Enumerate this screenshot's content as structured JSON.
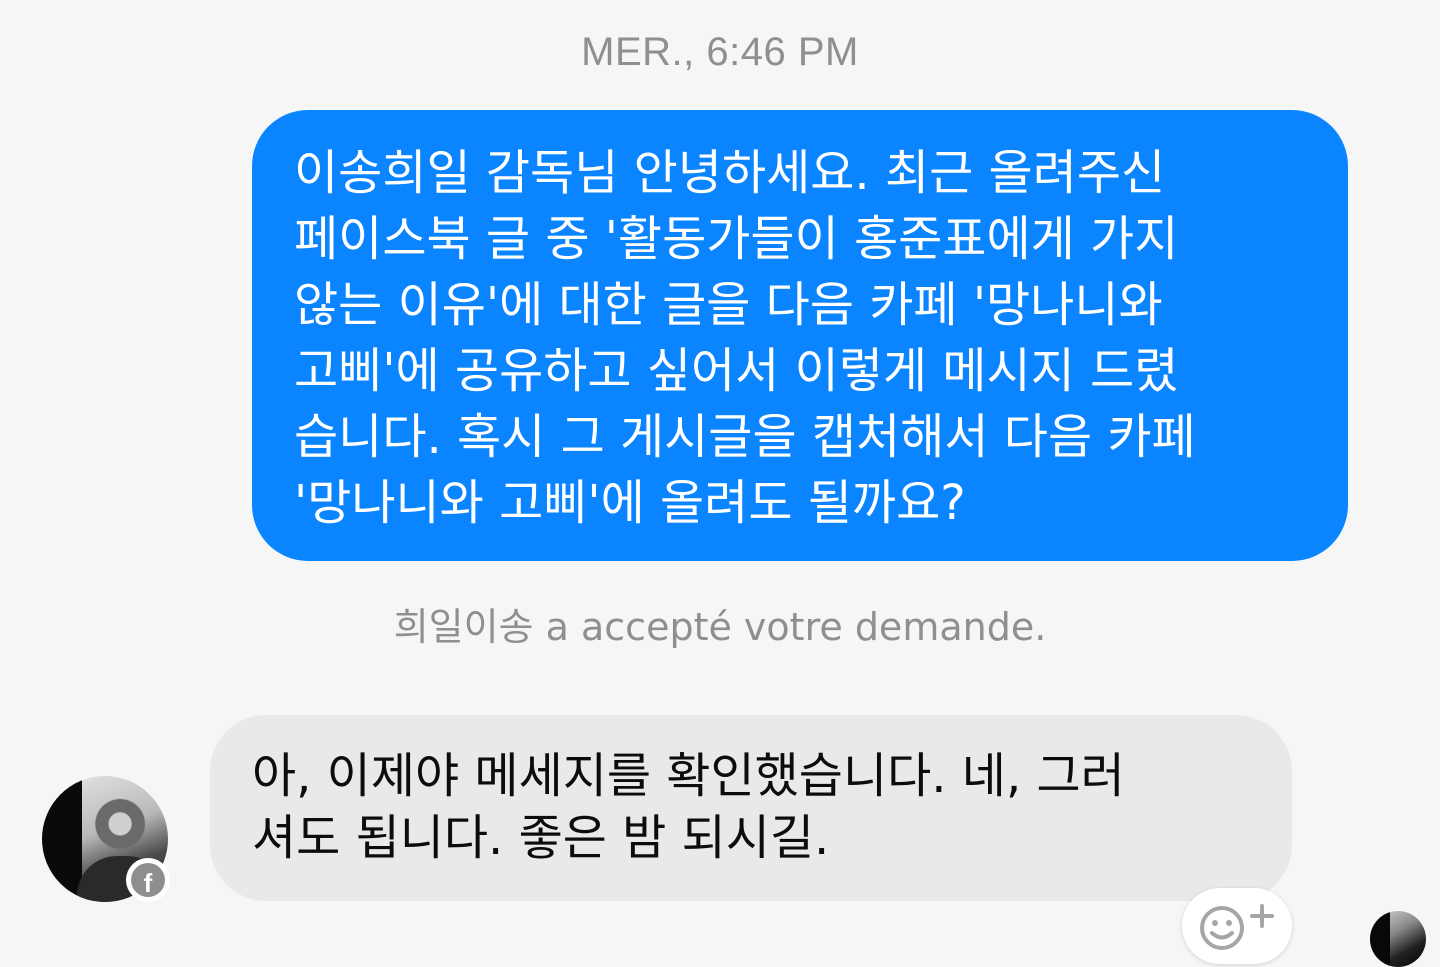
{
  "conversation": {
    "timestamp": "MER., 6:46 PM",
    "outgoing_message": {
      "lines": [
        "이송희일 감독님 안녕하세요. 최근 올려주신",
        "페이스북 글 중 '활동가들이 홍준표에게 가지",
        "않는 이유'에 대한 글을 다음 카페 '망나니와",
        "고삐'에 공유하고 싶어서 이렇게 메시지 드렸",
        "습니다. 혹시 그 게시글을 캡처해서 다음 카페",
        "'망나니와 고삐'에 올려도 될까요?"
      ]
    },
    "system_note": "희일이송 a accepté votre demande.",
    "incoming_message": {
      "lines": [
        "아, 이제야 메세지를 확인했습니다. 네, 그러",
        "셔도 됩니다. 좋은 밤 되시길."
      ]
    },
    "badge_icon": "facebook-icon",
    "badge_glyph": "f",
    "reaction_icon": "smiley-plus-icon"
  },
  "colors": {
    "outgoing_bubble": "#0a84ff",
    "incoming_bubble": "#e9e9e9",
    "background": "#f6f6f6",
    "meta_text": "#8f8f8f"
  }
}
